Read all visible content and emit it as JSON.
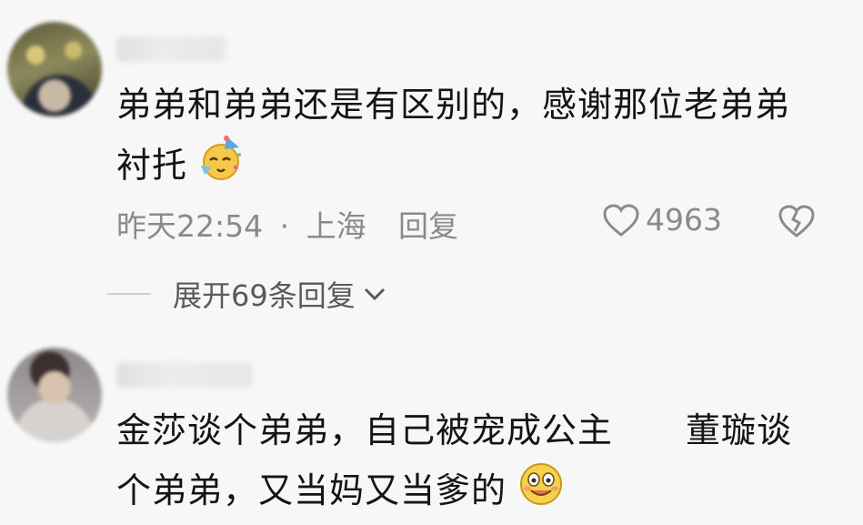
{
  "comments": [
    {
      "text_line1": "弟弟和弟弟还是有区别的，感谢那位老弟弟",
      "text_line2": "衬托",
      "emoji": "party-face-icon",
      "time": "昨天22:54",
      "dot": "·",
      "location": "上海",
      "reply_label": "回复",
      "likes": "4963",
      "expand_label": "展开69条回复"
    },
    {
      "text_line1": "金莎谈个弟弟，自己被宠成公主",
      "text_line1b": "董璇谈",
      "text_line2": "个弟弟，又当妈又当爹的",
      "emoji": "smiling-face-icon"
    }
  ],
  "colors": {
    "background": "#f7f7f7",
    "text": "#141414",
    "meta": "#8a8a8a"
  }
}
